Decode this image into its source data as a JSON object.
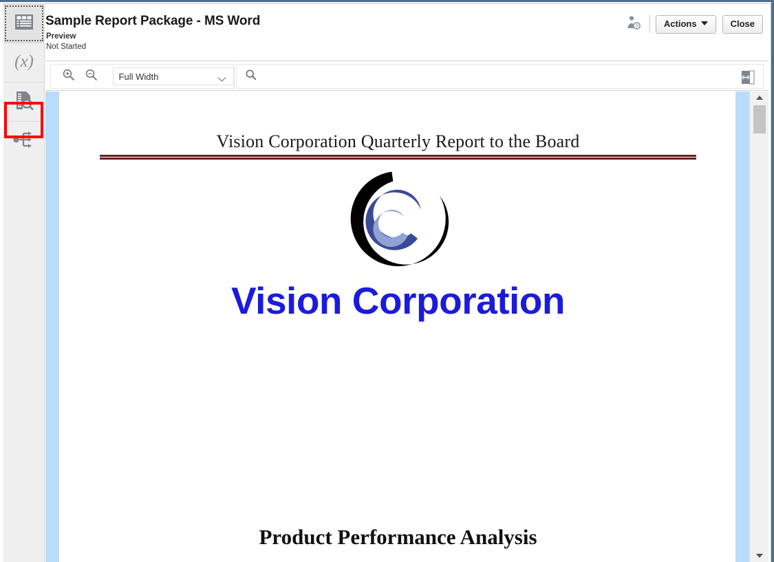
{
  "window": {
    "border_color": "#4f6f8a"
  },
  "sidebar": {
    "items": [
      {
        "name": "report-center",
        "icon": "table-grid-icon",
        "selected": true
      },
      {
        "name": "variables",
        "icon": "variables-x-icon",
        "selected": false
      },
      {
        "name": "preview",
        "icon": "document-search-icon",
        "selected": false,
        "highlighted": true
      },
      {
        "name": "workflow",
        "icon": "flow-branch-icon",
        "selected": false
      }
    ],
    "highlight_color": "#ff0000"
  },
  "header": {
    "title": "Sample Report Package - MS Word",
    "subtitle": "Preview",
    "status": "Not Started",
    "user_icon": "user-help-icon",
    "actions_label": "Actions",
    "close_label": "Close"
  },
  "toolbar": {
    "zoom_in_icon": "zoom-in-icon",
    "zoom_out_icon": "zoom-out-icon",
    "zoom_level": "Full Width",
    "zoom_options": [
      "Full Width"
    ],
    "search_icon": "search-icon",
    "search_value": "",
    "search_placeholder": "",
    "panel_toggle_icon": "expand-panel-icon"
  },
  "scrollbar": {
    "up_icon": "scroll-up-arrow-icon",
    "down_icon": "scroll-down-arrow-icon"
  },
  "document": {
    "header_text": "Vision Corporation Quarterly Report to the Board",
    "header_rule_color": "#632323",
    "logo_alt": "vision-corporation-logo",
    "logo_colors": {
      "outer": "#000000",
      "middle": "#3b4a96",
      "inner": "#8fa2d4"
    },
    "company_name": "Vision Corporation",
    "company_name_color": "#1b1bdd",
    "section_heading": "Product Performance Analysis",
    "page_margin_color": "#b9dcfb"
  }
}
